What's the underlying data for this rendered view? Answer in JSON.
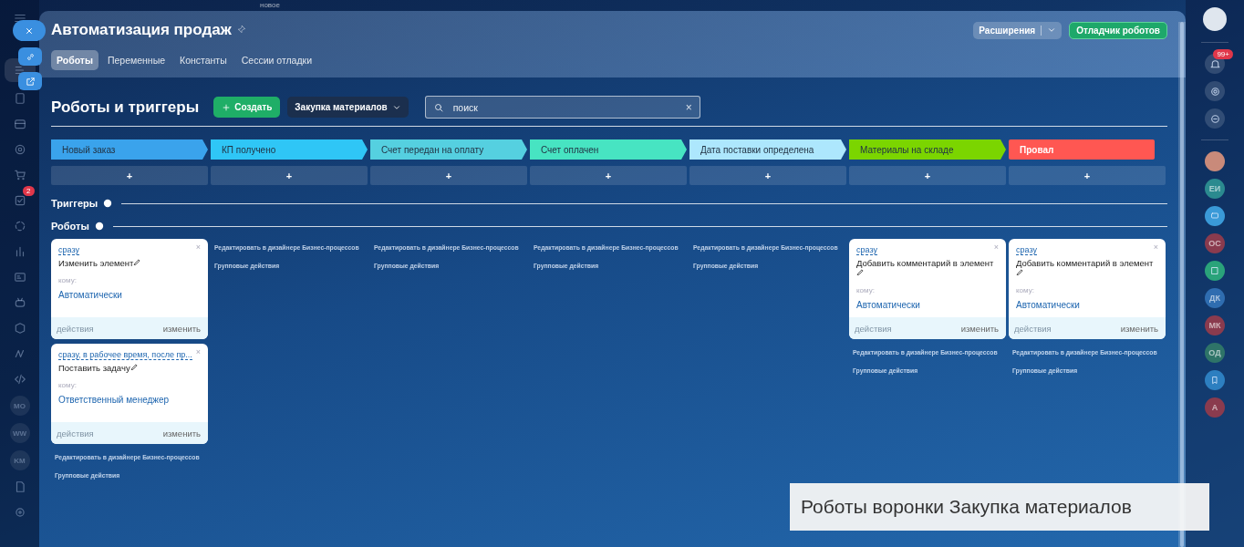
{
  "top_hint": "новое",
  "left_sidebar": {
    "tasks_badge": "2",
    "shortcuts": [
      "MO",
      "WW",
      "KM"
    ]
  },
  "window": {
    "title": "Автоматизация продаж"
  },
  "header_buttons": {
    "extensions": "Расширения",
    "debugger": "Отладчик роботов"
  },
  "tabs": [
    {
      "label": "Роботы",
      "selected": true
    },
    {
      "label": "Переменные",
      "selected": false
    },
    {
      "label": "Константы",
      "selected": false
    },
    {
      "label": "Сессии отладки",
      "selected": false
    }
  ],
  "toolbar": {
    "heading": "Роботы и триггеры",
    "create": "Создать",
    "pipeline": "Закупка материалов",
    "search": {
      "placeholder": "поиск",
      "clear": "×"
    }
  },
  "stages": [
    {
      "name": "Новый заказ",
      "color": "#3aa3ec",
      "add": "+"
    },
    {
      "name": "КП получено",
      "color": "#2fc6f6",
      "add": "+"
    },
    {
      "name": "Счет передан на оплату",
      "color": "#55d0e0",
      "add": "+"
    },
    {
      "name": "Счет оплачен",
      "color": "#47e4c2",
      "add": "+"
    },
    {
      "name": "Дата поставки определена",
      "color": "#ade7fd",
      "add": "+"
    },
    {
      "name": "Материалы на складе",
      "color": "#7bd500",
      "add": "+"
    },
    {
      "name": "Провал",
      "color": "#ff5752",
      "add": "+"
    }
  ],
  "sections": {
    "triggers": "Триггеры",
    "robots": "Роботы"
  },
  "columns": [
    {
      "robots": [
        {
          "delay": "сразу",
          "name": "Изменить элемент",
          "to_label": "кому:",
          "to": "Автоматически",
          "actions": "действия",
          "edit": "изменить",
          "close": "×"
        },
        {
          "delay": "сразу, в рабочее время, после пр...",
          "name": "Поставить задачу",
          "to_label": "кому:",
          "to": "Ответственный менеджер",
          "actions": "действия",
          "edit": "изменить",
          "close": "×"
        }
      ],
      "designer": "Редактировать в дизайнере Бизнес-процессов",
      "group": "Групповые действия"
    },
    {
      "designer": "Редактировать в дизайнере Бизнес-процессов",
      "group": "Групповые действия"
    },
    {
      "designer": "Редактировать в дизайнере Бизнес-процессов",
      "group": "Групповые действия"
    },
    {
      "designer": "Редактировать в дизайнере Бизнес-процессов",
      "group": "Групповые действия"
    },
    {
      "designer": "Редактировать в дизайнере Бизнес-процессов",
      "group": "Групповые действия"
    },
    {
      "robots": [
        {
          "delay": "сразу",
          "name": "Добавить комментарий в элемент",
          "to_label": "кому:",
          "to": "Автоматически",
          "actions": "действия",
          "edit": "изменить",
          "close": "×"
        }
      ],
      "designer": "Редактировать в дизайнере Бизнес-процессов",
      "group": "Групповые действия"
    },
    {
      "robots": [
        {
          "delay": "сразу",
          "name": "Добавить комментарий в элемент",
          "to_label": "кому:",
          "to": "Автоматически",
          "actions": "действия",
          "edit": "изменить",
          "close": "×"
        }
      ],
      "designer": "Редактировать в дизайнере Бизнес-процессов",
      "group": "Групповые действия"
    }
  ],
  "right_sidebar": {
    "notifications_badge": "99+",
    "avatars": [
      {
        "initials": "ЕИ",
        "color": "#2b8a8f"
      },
      {
        "initials": "ОС",
        "color": "#8a3b4e"
      },
      {
        "initials": "ДК",
        "color": "#2f6db0"
      },
      {
        "initials": "МК",
        "color": "#8a3b4e"
      },
      {
        "initials": "ОД",
        "color": "#2e7468"
      },
      {
        "initials": "А",
        "color": "#8a3b4e"
      }
    ]
  },
  "caption": "Роботы воронки Закупка материалов"
}
